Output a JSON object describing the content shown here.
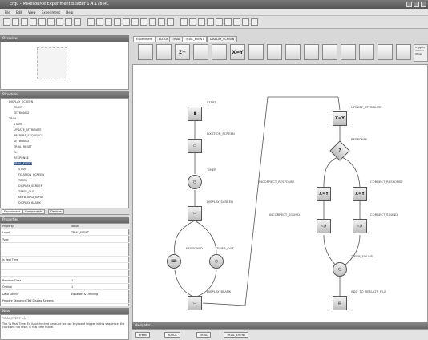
{
  "window": {
    "title": "Erqu - MiResource Experiment Builder 1.4.178 RC"
  },
  "menu": [
    "File",
    "Edit",
    "View",
    "Experiment",
    "Help"
  ],
  "panels": {
    "overview": "Overview",
    "structure": "Structure",
    "properties": "Properties",
    "note": "Note",
    "navigator": "Navigator"
  },
  "tabs": [
    "Experiment",
    "BLOCK",
    "TRIAL",
    "TRIAL_EVENT",
    "DISPLAY_SCREEN"
  ],
  "structure_tabs": [
    "Experiment",
    "Components",
    "Devices"
  ],
  "tree": [
    "DISPLAY_SCREEN",
    "TIMER",
    "KEYBOARD",
    "TRIAL",
    "START",
    "UPDATE_ATTRIBUTE",
    "PREPARE_SEQUENCE",
    "KEYBOARD",
    "TRIAL_RESET",
    "EL",
    "RESPONSE",
    "TRIAL_EVENT",
    "START",
    "FIXATION_SCREEN",
    "TIMER",
    "DISPLAY_SCREEN",
    "TIMER_OUT",
    "KEYBOARD_INPUT",
    "DISPLAY_BLANK"
  ],
  "properties": {
    "headers": [
      "Property",
      "Value"
    ],
    "rows": [
      [
        "Label",
        "TRIAL_EVENT"
      ],
      [
        "Type",
        ""
      ],
      [
        "",
        ""
      ],
      [
        "",
        ""
      ],
      [
        "Is Real Time",
        ""
      ],
      [
        "",
        ""
      ],
      [
        "",
        ""
      ],
      [
        "Random Class",
        "1"
      ],
      [
        "Ordinal",
        "1"
      ],
      [
        "Data Source",
        "Equation & Offlining"
      ],
      [
        "Prepare Sequence/Tail Display Screens",
        ""
      ]
    ]
  },
  "note": {
    "title": "TRIAL_EVENT Info",
    "text": "The 'Is Real Time' Ex is unchecked because we use keyboard trigger in this sequence; the clock will not reset in real time mode."
  },
  "diagram_labels": {
    "start": "START",
    "fixation": "FIXATION_SCREEN",
    "timer": "TIMER",
    "display": "DISPLAY_SCREEN",
    "keyboard": "KEYBOARD",
    "timer_out": "TIMER_OUT",
    "display_blank": "DISPLAY_BLANK",
    "update": "UPDATE_ATTRIBUTE",
    "response": "RESPONSE",
    "incorrect": "INCORRECT_RESPONSE",
    "correct": "CORRECT_RESPONSE",
    "incorrect_sound": "INCORRECT_SOUND",
    "correct_sound": "CORRECT_SOUND",
    "timer_sound": "TIMER_SOUND",
    "add_results": "ADD_TO_RESULTS_FILE",
    "xy": "X=Y"
  },
  "palette_text": [
    "",
    "",
    "Σ+",
    "",
    "",
    "X=Y",
    "",
    "",
    "",
    "",
    "",
    "",
    "",
    "",
    ""
  ],
  "navigator": {
    "crumbs": [
      "Break",
      "BLOCK",
      "TRIAL",
      "TRIAL_EVENT"
    ]
  },
  "right_tabs": [
    "Triggers",
    "Actions",
    "Other"
  ]
}
